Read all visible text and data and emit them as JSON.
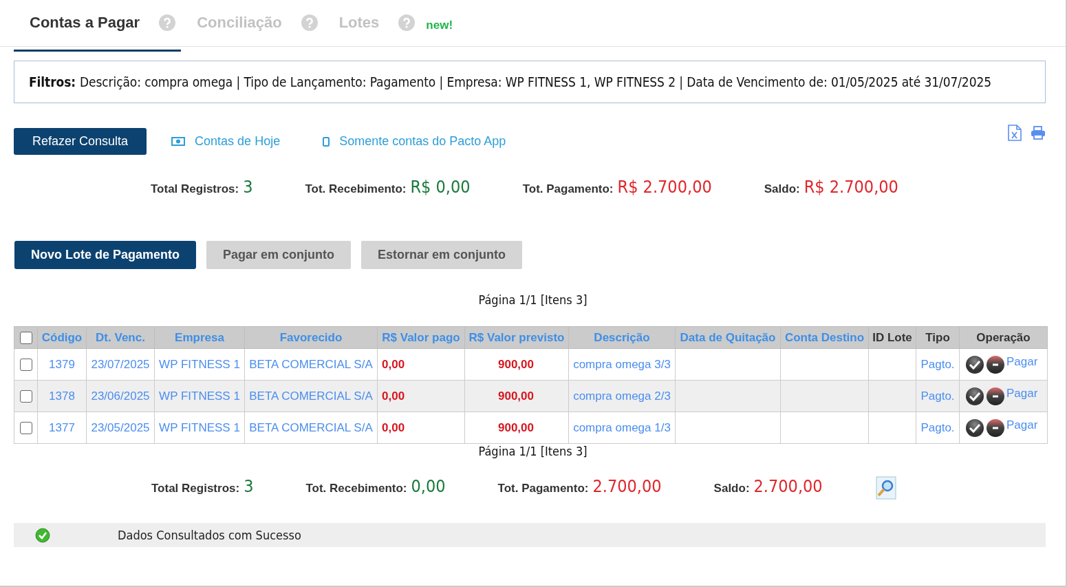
{
  "tabs": [
    {
      "label": "Contas a Pagar",
      "selected": true
    },
    {
      "label": "Conciliação",
      "selected": false
    },
    {
      "label": "Lotes",
      "selected": false,
      "badge": "new!"
    }
  ],
  "filters": {
    "label": "Filtros:",
    "text": "Descrição: compra omega | Tipo de Lançamento: Pagamento | Empresa: WP FITNESS 1, WP FITNESS 2 | Data de Vencimento de: 01/05/2025 até 31/07/2025"
  },
  "query_button": "Refazer Consulta",
  "links": [
    {
      "kind": "money",
      "label": "Contas de Hoje"
    },
    {
      "kind": "phone",
      "label": "Somente contas do Pacto App"
    }
  ],
  "totals_top": [
    {
      "label": "Total Registros:",
      "value": "3",
      "color": "#1a7a3c"
    },
    {
      "label": "Tot. Recebimento:",
      "value": "R$ 0,00",
      "color": "#1a7a3c"
    },
    {
      "label": "Tot. Pagamento:",
      "value": "R$ 2.700,00",
      "color": "#e0262c"
    },
    {
      "label": "Saldo:",
      "value": "R$ 2.700,00",
      "color": "#e0262c"
    }
  ],
  "batch_buttons": [
    {
      "label": "Novo Lote de Pagamento",
      "disabled": false
    },
    {
      "label": "Pagar em conjunto",
      "disabled": true
    },
    {
      "label": "Estornar em conjunto",
      "disabled": true
    }
  ],
  "pagination_top": "Página 1/1 [Itens 3]",
  "table": {
    "select_all": false,
    "columns": [
      {
        "label": "Código",
        "sortable": true
      },
      {
        "label": "Dt. Venc.",
        "sortable": true
      },
      {
        "label": "Empresa",
        "sortable": true
      },
      {
        "label": "Favorecido",
        "sortable": true
      },
      {
        "label": "R$ Valor pago",
        "sortable": true
      },
      {
        "label": "R$ Valor previsto",
        "sortable": true
      },
      {
        "label": "Descrição",
        "sortable": true
      },
      {
        "label": "Data de Quitação",
        "sortable": true
      },
      {
        "label": "Conta Destino",
        "sortable": true
      },
      {
        "label": "ID Lote",
        "sortable": false
      },
      {
        "label": "Tipo",
        "sortable": false
      },
      {
        "label": "Operação",
        "sortable": false
      }
    ],
    "rows": [
      {
        "checked": false,
        "code": "1379",
        "due": "23/07/2025",
        "company": "WP FITNESS 1",
        "payee": "BETA COMERCIAL S/A",
        "paid": "0,00",
        "expected": "900,00",
        "description": "compra omega 3/3",
        "type": "Pagto.",
        "action": "Pagar"
      },
      {
        "checked": false,
        "code": "1378",
        "due": "23/06/2025",
        "company": "WP FITNESS 1",
        "payee": "BETA COMERCIAL S/A",
        "paid": "0,00",
        "expected": "900,00",
        "description": "compra omega 2/3",
        "type": "Pagto.",
        "action": "Pagar"
      },
      {
        "checked": false,
        "code": "1377",
        "due": "23/05/2025",
        "company": "WP FITNESS 1",
        "payee": "BETA COMERCIAL S/A",
        "paid": "0,00",
        "expected": "900,00",
        "description": "compra omega 1/3",
        "type": "Pagto.",
        "action": "Pagar"
      }
    ]
  },
  "pagination_bottom": "Página 1/1 [Itens 3]",
  "totals_bottom": [
    {
      "label": "Total Registros:",
      "value": "3",
      "color": "#1a7a3c"
    },
    {
      "label": "Tot. Recebimento:",
      "value": "0,00",
      "color": "#1a7a3c"
    },
    {
      "label": "Tot. Pagamento:",
      "value": "2.700,00",
      "color": "#e0262c"
    },
    {
      "label": "Saldo:",
      "value": "2.700,00",
      "color": "#e0262c"
    }
  ],
  "status": "Dados Consultados com Sucesso"
}
